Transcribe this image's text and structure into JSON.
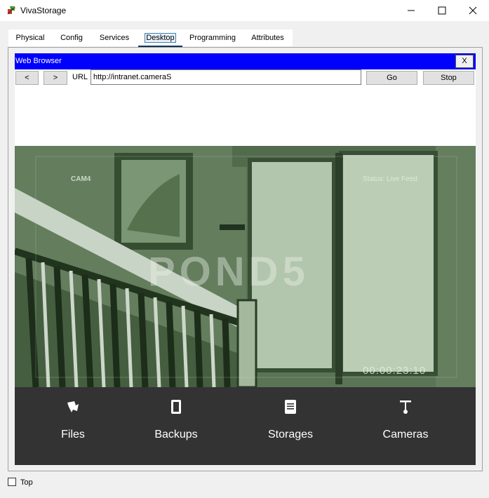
{
  "window": {
    "title": "VivaStorage"
  },
  "tabs": [
    "Physical",
    "Config",
    "Services",
    "Desktop",
    "Programming",
    "Attributes"
  ],
  "active_tab": "Desktop",
  "browser": {
    "title": "Web Browser",
    "close_label": "X",
    "back_label": "<",
    "forward_label": ">",
    "url_label": "URL",
    "url_value": "http://intranet.cameraS",
    "go_label": "Go",
    "stop_label": "Stop"
  },
  "camera_feed": {
    "cam_label": "CAM4",
    "status": "Status: Live Feed",
    "timestamp": "00:00:23:10",
    "watermark": "POND5"
  },
  "nav": [
    {
      "label": "Files",
      "icon": "upload-icon"
    },
    {
      "label": "Backups",
      "icon": "tablet-icon"
    },
    {
      "label": "Storages",
      "icon": "document-icon"
    },
    {
      "label": "Cameras",
      "icon": "camera-icon"
    }
  ],
  "footer": {
    "top_label": "Top",
    "top_checked": false
  },
  "colors": {
    "browser_title_bg": "#0000ff",
    "nav_bg": "#333333",
    "active_tab_underline": "#10355c"
  }
}
